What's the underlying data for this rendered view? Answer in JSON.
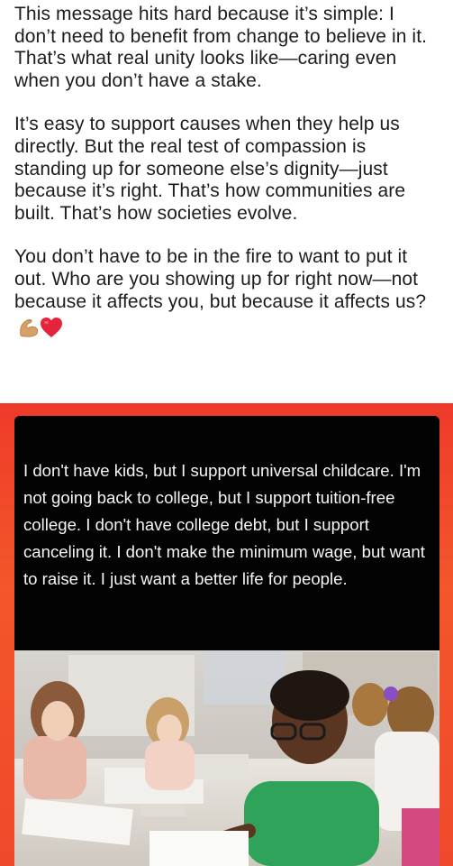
{
  "post": {
    "paragraphs": [
      "This message hits hard because it’s simple: I don’t need to benefit from change to believe in it. That’s what real unity looks like—caring even when you don’t have a stake.",
      "It’s easy to support causes when they help us directly. But the real test of compassion is standing up for someone else’s dignity—just because it’s right. That’s how communities are built. That’s how societies evolve.",
      "You don’t have to be in the fire to want to put it out. Who are you showing up for right now—not because it affects you, but because it affects us?"
    ],
    "emojis": [
      "flexed-biceps",
      "red-heart"
    ]
  },
  "meme": {
    "quote": "I don't have kids, but I support universal childcare. I'm not going back to college, but I support tuition-free college. I don't have college debt, but I support canceling it. I don't make the minimum wage, but want to raise it. I just want a better life for people."
  },
  "colors": {
    "frame_red": "#ef3a2a",
    "card_black": "#030303",
    "quote_text": "#f5f5f5",
    "boy_shirt_green": "#2fa35a"
  }
}
